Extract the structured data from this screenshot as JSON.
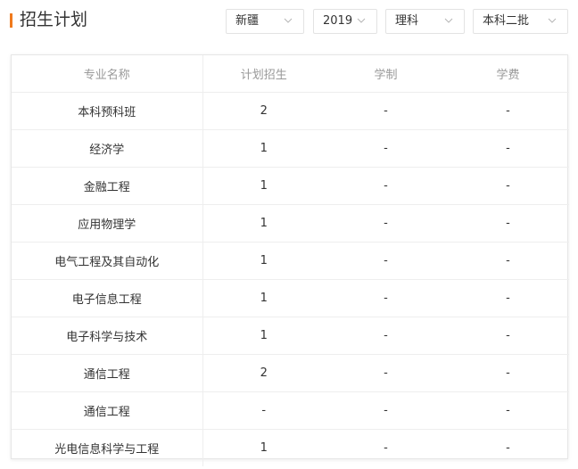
{
  "header": {
    "title": "招生计划"
  },
  "filters": {
    "province": "新疆",
    "year": "2019",
    "subject": "理科",
    "batch": "本科二批"
  },
  "colors": {
    "accent": "#f07a1d",
    "header_text": "#999999",
    "body_text": "#333333",
    "border": "#eeeeee"
  },
  "table": {
    "columns": [
      "专业名称",
      "计划招生",
      "学制",
      "学费"
    ],
    "rows": [
      [
        "本科预科班",
        "2",
        "-",
        "-"
      ],
      [
        "经济学",
        "1",
        "-",
        "-"
      ],
      [
        "金融工程",
        "1",
        "-",
        "-"
      ],
      [
        "应用物理学",
        "1",
        "-",
        "-"
      ],
      [
        "电气工程及其自动化",
        "1",
        "-",
        "-"
      ],
      [
        "电子信息工程",
        "1",
        "-",
        "-"
      ],
      [
        "电子科学与技术",
        "1",
        "-",
        "-"
      ],
      [
        "通信工程",
        "2",
        "-",
        "-"
      ],
      [
        "通信工程",
        "-",
        "-",
        "-"
      ],
      [
        "光电信息科学与工程",
        "1",
        "-",
        "-"
      ]
    ]
  }
}
